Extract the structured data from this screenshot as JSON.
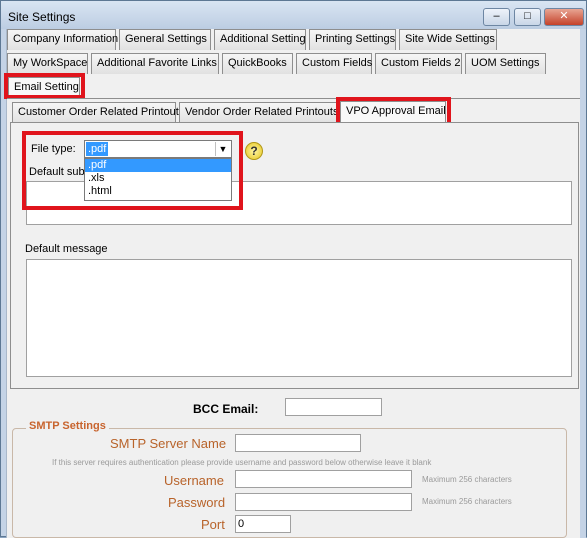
{
  "window": {
    "title": "Site Settings",
    "minimize_glyph": "–",
    "maximize_glyph": "□",
    "close_glyph": "✕"
  },
  "main_tabs": {
    "row1": [
      "Company Information",
      "General Settings",
      "Additional Setting",
      "Printing Settings",
      "Site Wide Settings"
    ],
    "row2": [
      "My WorkSpace",
      "Additional Favorite Links",
      "QuickBooks",
      "Custom Fields",
      "Custom Fields 2",
      "UOM Settings"
    ],
    "row3": [
      "Email Setting"
    ]
  },
  "sub_tabs": [
    "Customer Order Related Printouts",
    "Vendor Order Related Printouts",
    "VPO Approval Email"
  ],
  "form": {
    "file_type_label": "File type:",
    "file_type_value": ".pdf",
    "file_type_options": [
      ".pdf",
      ".xls",
      ".html"
    ],
    "help_glyph": "?",
    "default_subject_label": "Default subject",
    "default_message_label": "Default message"
  },
  "bcc": {
    "label": "BCC Email:",
    "value": ""
  },
  "smtp": {
    "legend": "SMTP Settings",
    "server_label": "SMTP Server Name",
    "server_value": "",
    "auth_hint": "If this server requires authentication please provide username and password below otherwise leave it blank",
    "username_label": "Username",
    "username_value": "",
    "password_label": "Password",
    "password_value": "",
    "max_hint": "Maximum 256 characters",
    "port_label": "Port",
    "port_value": "0"
  },
  "colors": {
    "highlight_red": "#e0141c",
    "selection_blue": "#3399ff",
    "smtp_orange": "#c8642e"
  }
}
